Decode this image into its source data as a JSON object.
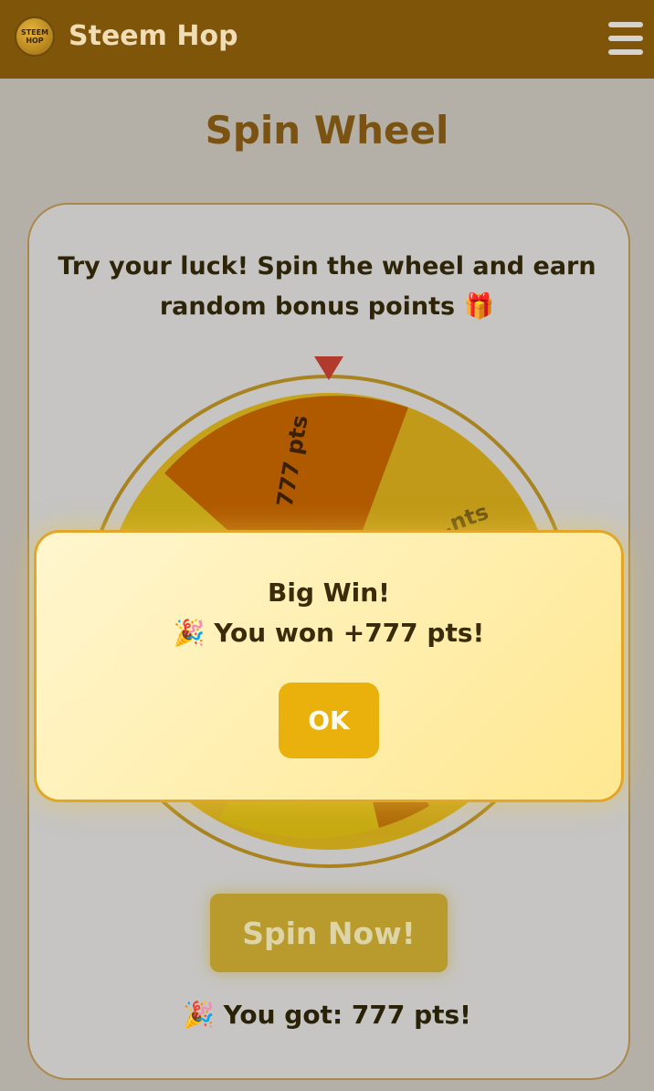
{
  "header": {
    "brand": "Steem Hop",
    "logo_text_top": "STEEM",
    "logo_text_bottom": "HOP",
    "menu_icon": "hamburger-menu-icon"
  },
  "page": {
    "title": "Spin Wheel",
    "intro": "Try your luck! Spin the wheel and earn random bonus points 🎁"
  },
  "wheel": {
    "pointer_icon": "triangle-down-icon",
    "visible_labels": [
      "777 pts",
      "…nts"
    ],
    "colors": {
      "orange": "#b05a00",
      "gold": "#c6a11a",
      "yellow": "#c6ad10",
      "rim": "#a8831f"
    }
  },
  "spin_button": {
    "label": "Spin Now!"
  },
  "result_text": "🎉 You got: 777 pts!",
  "modal": {
    "title": "Big Win!",
    "message": "🎉 You won +777 pts!",
    "ok_label": "OK"
  },
  "colors": {
    "header_bg": "#7f5509",
    "accent": "#eab00b",
    "title": "#7a5312"
  }
}
